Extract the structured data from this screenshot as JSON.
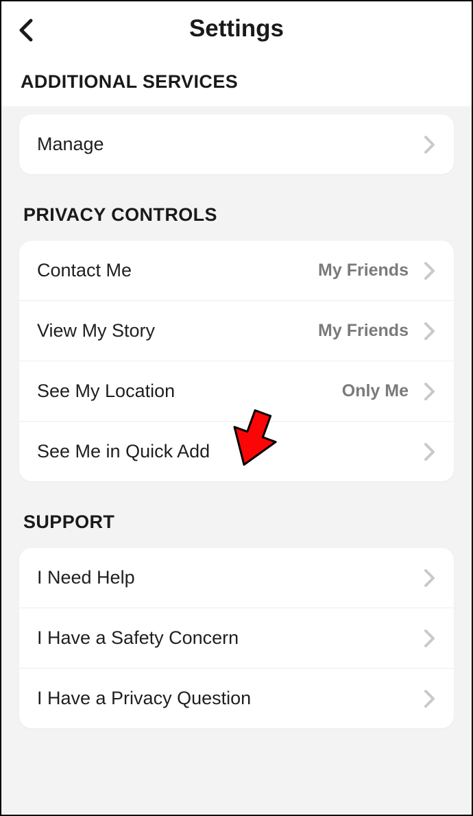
{
  "header": {
    "title": "Settings"
  },
  "sections": {
    "additional_services": {
      "title": "ADDITIONAL SERVICES",
      "items": [
        {
          "label": "Manage",
          "value": ""
        }
      ]
    },
    "privacy_controls": {
      "title": "PRIVACY CONTROLS",
      "items": [
        {
          "label": "Contact Me",
          "value": "My Friends"
        },
        {
          "label": "View My Story",
          "value": "My Friends"
        },
        {
          "label": "See My Location",
          "value": "Only Me"
        },
        {
          "label": "See Me in Quick Add",
          "value": ""
        }
      ]
    },
    "support": {
      "title": "SUPPORT",
      "items": [
        {
          "label": "I Need Help",
          "value": ""
        },
        {
          "label": "I Have a Safety Concern",
          "value": ""
        },
        {
          "label": "I Have a Privacy Question",
          "value": ""
        }
      ]
    }
  }
}
